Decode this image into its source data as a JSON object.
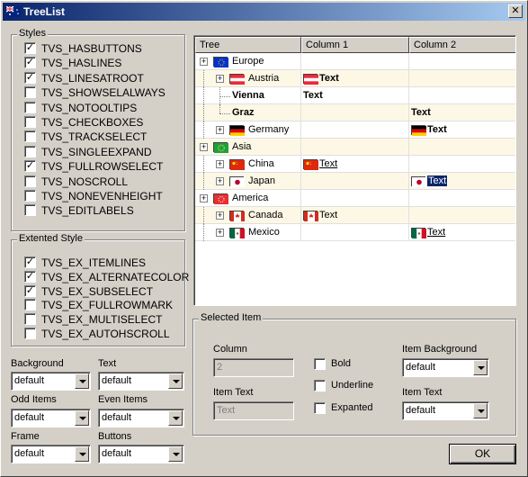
{
  "window": {
    "title": "TreeList",
    "close_glyph": "✕"
  },
  "styles": {
    "label": "Styles",
    "items": [
      {
        "label": "TVS_HASBUTTONS",
        "checked": true
      },
      {
        "label": "TVS_HASLINES",
        "checked": true
      },
      {
        "label": "TVS_LINESATROOT",
        "checked": true
      },
      {
        "label": "TVS_SHOWSELALWAYS",
        "checked": false
      },
      {
        "label": "TVS_NOTOOLTIPS",
        "checked": false
      },
      {
        "label": "TVS_CHECKBOXES",
        "checked": false
      },
      {
        "label": "TVS_TRACKSELECT",
        "checked": false
      },
      {
        "label": "TVS_SINGLEEXPAND",
        "checked": false
      },
      {
        "label": "TVS_FULLROWSELECT",
        "checked": true
      },
      {
        "label": "TVS_NOSCROLL",
        "checked": false
      },
      {
        "label": "TVS_NONEVENHEIGHT",
        "checked": false
      },
      {
        "label": "TVS_EDITLABELS",
        "checked": false
      }
    ]
  },
  "extended_style": {
    "label": "Extented Style",
    "items": [
      {
        "label": "TVS_EX_ITEMLINES",
        "checked": true
      },
      {
        "label": "TVS_EX_ALTERNATECOLOR",
        "checked": true
      },
      {
        "label": "TVS_EX_SUBSELECT",
        "checked": true
      },
      {
        "label": "TVS_EX_FULLROWMARK",
        "checked": false
      },
      {
        "label": "TVS_EX_MULTISELECT",
        "checked": false
      },
      {
        "label": "TVS_EX_AUTOHSCROLL",
        "checked": false
      }
    ]
  },
  "colors": {
    "background": {
      "label": "Background",
      "value": "default"
    },
    "text": {
      "label": "Text",
      "value": "default"
    },
    "odd_items": {
      "label": "Odd Items",
      "value": "default"
    },
    "even_items": {
      "label": "Even Items",
      "value": "default"
    },
    "frame": {
      "label": "Frame",
      "value": "default"
    },
    "buttons": {
      "label": "Buttons",
      "value": "default"
    }
  },
  "tree": {
    "columns": [
      "Tree",
      "Column 1",
      "Column 2"
    ],
    "rows": [
      {
        "label": "Europe",
        "flag": "eu-flag-icon"
      },
      {
        "label": "Austria",
        "flag": "austria-flag-icon",
        "c1": "Text",
        "c1_flag": "austria-flag-icon"
      },
      {
        "label": "Vienna",
        "c1": "Text"
      },
      {
        "label": "Graz",
        "c2": "Text"
      },
      {
        "label": "Germany",
        "flag": "germany-flag-icon",
        "c2": "Text",
        "c2_flag": "germany-flag-icon"
      },
      {
        "label": "Asia",
        "flag": "asia-icon"
      },
      {
        "label": "China",
        "flag": "china-flag-icon",
        "c1": "Text",
        "c1_flag": "china-flag-icon"
      },
      {
        "label": "Japan",
        "flag": "japan-flag-icon",
        "c2": "Text",
        "c2_flag": "japan-flag-icon"
      },
      {
        "label": "America",
        "flag": "america-icon"
      },
      {
        "label": "Canada",
        "flag": "canada-flag-icon",
        "c1": "Text",
        "c1_flag": "canada-flag-icon"
      },
      {
        "label": "Mexico",
        "flag": "mexico-flag-icon",
        "c2": "Text",
        "c2_flag": "mexico-flag-icon"
      }
    ],
    "expander_glyph": "+"
  },
  "selected_item": {
    "label": "Selected Item",
    "column_label": "Column",
    "column_value": "2",
    "item_text_label": "Item Text",
    "item_text_value": "Text",
    "bold_label": "Bold",
    "underline_label": "Underline",
    "expanted_label": "Expanted",
    "item_background_label": "Item Background",
    "item_background_value": "default",
    "item_text_color_label": "Item Text",
    "item_text_color_value": "default"
  },
  "ok_label": "OK",
  "check_glyph": "✓",
  "accent": {
    "title_start": "#0a246a",
    "title_end": "#a6caf0",
    "alt_row": "#fdf8e6"
  }
}
